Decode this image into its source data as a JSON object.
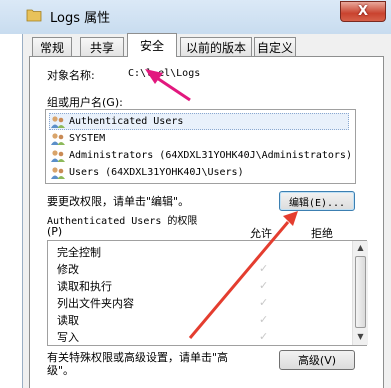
{
  "window": {
    "title": "Logs 属性",
    "close_glyph": "X"
  },
  "tabs": [
    {
      "label": "常规"
    },
    {
      "label": "共享"
    },
    {
      "label": "安全"
    },
    {
      "label": "以前的版本"
    },
    {
      "label": "自定义"
    }
  ],
  "object": {
    "label": "对象名称:",
    "value": "C:\\l  el\\Logs"
  },
  "groups": {
    "label": "组或用户名(G):",
    "items": [
      {
        "name": "Authenticated Users"
      },
      {
        "name": "SYSTEM"
      },
      {
        "name": "Administrators (64XDXL31YOHK40J\\Administrators)"
      },
      {
        "name": "Users (64XDXL31YOHK40J\\Users)"
      }
    ]
  },
  "change_hint": "要更改权限，请单击\"编辑\"。",
  "edit_button": "编辑(E)...",
  "permissions": {
    "title": "Authenticated Users 的权限",
    "access_key": "(P)",
    "allow_header": "允许",
    "deny_header": "拒绝",
    "rows": [
      {
        "name": "完全控制",
        "allow": false
      },
      {
        "name": "修改",
        "allow": true
      },
      {
        "name": "读取和执行",
        "allow": true
      },
      {
        "name": "列出文件夹内容",
        "allow": true
      },
      {
        "name": "读取",
        "allow": true
      },
      {
        "name": "写入",
        "allow": true
      }
    ]
  },
  "special_hint_line1": "有关特殊权限或高级设置，请单击\"高",
  "special_hint_line2": "级\"。",
  "advanced_button": "高级(V)",
  "colors": {
    "annotation_arrow": "#e2187e",
    "annotation_arrow_red": "#e43d2f"
  },
  "icons": [
    "folder-icon",
    "users-icon",
    "checkmark-icon",
    "scroll-up-icon",
    "scroll-down-icon"
  ]
}
